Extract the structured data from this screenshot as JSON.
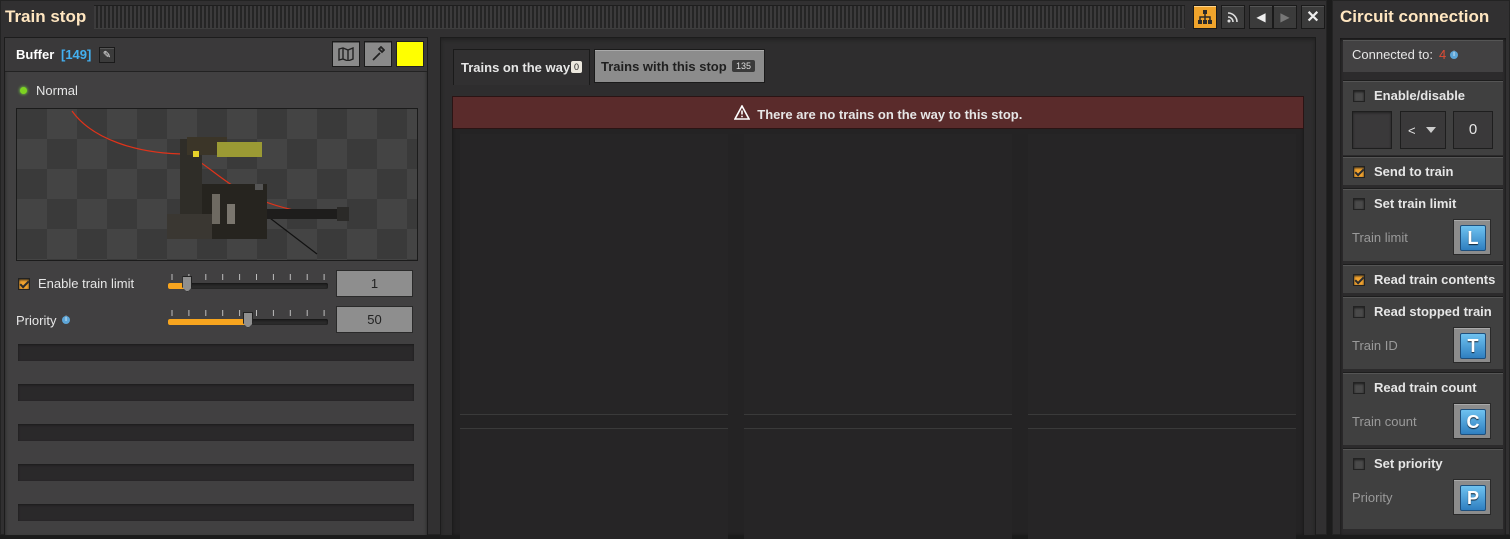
{
  "train_stop": {
    "title": "Train stop",
    "name": "Buffer",
    "count": "[149]",
    "status": "Normal",
    "enable_train_limit_label": "Enable train limit",
    "train_limit_value": "1",
    "train_limit_level": 0.1,
    "priority_label": "Priority",
    "priority_value": "50",
    "priority_level": 0.5,
    "tabs": [
      {
        "label": "Trains on the way",
        "badge": "0"
      },
      {
        "label": "Trains with this stop",
        "badge": "135"
      }
    ],
    "warning": "There are no trains on the way to this stop."
  },
  "circuit": {
    "title": "Circuit connection",
    "connected_label": "Connected to:",
    "connected_value": "4",
    "enable_disable": "Enable/disable",
    "comparator": "<",
    "constant": "0",
    "send_to_train": "Send to train",
    "set_train_limit": "Set train limit",
    "train_limit": "Train limit",
    "train_limit_signal": "L",
    "read_train_contents": "Read train contents",
    "read_stopped_train": "Read stopped train",
    "train_id": "Train ID",
    "train_id_signal": "T",
    "read_train_count": "Read train count",
    "train_count": "Train count",
    "train_count_signal": "C",
    "set_priority": "Set priority",
    "priority": "Priority",
    "priority_signal": "P"
  },
  "colors": {
    "accent": "#f2a32f",
    "station_color": "#ffff00",
    "warning_bg": "#5a2b2b",
    "count_blue": "#43b0f0"
  },
  "icons": [
    "network-icon",
    "wifi-icon",
    "prev-icon",
    "next-icon",
    "close-icon",
    "rename-icon",
    "map-icon",
    "eyedropper-icon",
    "info-icon",
    "warning-icon"
  ]
}
